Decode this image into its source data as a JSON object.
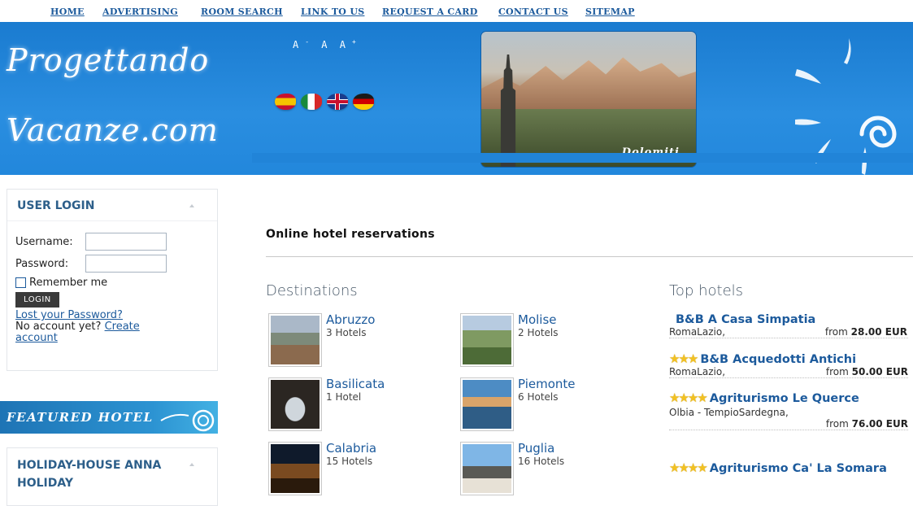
{
  "nav": {
    "items": [
      "HOME",
      "ADVERTISING",
      "ROOM SEARCH",
      "LINK TO US",
      "REQUEST A CARD",
      "CONTACT US",
      "SITEMAP"
    ]
  },
  "header": {
    "logo_line1": "Progettando",
    "logo_line2": "Vacanze.com",
    "font_small": "A",
    "font_normal": "A",
    "font_large": "A",
    "photo_label": "Dolomiti",
    "flags": [
      "Spanish",
      "Italian",
      "English",
      "German"
    ]
  },
  "login": {
    "title": "USER LOGIN",
    "username_label": "Username:",
    "password_label": "Password:",
    "remember_label": "Remember me",
    "login_button": "LOGIN",
    "lost_password": "Lost your Password?",
    "no_account": "No account yet?",
    "create_account": "Create account"
  },
  "featured_banner": "FEATURED HOTEL",
  "holiday_box": {
    "title_line1": "HOLIDAY-HOUSE ANNA",
    "title_line2": "HOLIDAY"
  },
  "main": {
    "page_title": "Online hotel reservations",
    "destinations_title": "Destinations",
    "top_hotels_title": "Top hotels"
  },
  "destinations": [
    {
      "name": "Abruzzo",
      "count": "3 Hotels"
    },
    {
      "name": "Molise",
      "count": "2 Hotels"
    },
    {
      "name": "Basilicata",
      "count": "1 Hotel"
    },
    {
      "name": "Piemonte",
      "count": "6 Hotels"
    },
    {
      "name": "Calabria",
      "count": "15 Hotels"
    },
    {
      "name": "Puglia",
      "count": "16 Hotels"
    }
  ],
  "hotels": [
    {
      "stars": 0,
      "name": "B&B A Casa Simpatia",
      "location": "RomaLazio,",
      "price_prefix": "from",
      "price": "28.00 EUR"
    },
    {
      "stars": 3,
      "name": "B&B Acquedotti Antichi",
      "location": "RomaLazio,",
      "price_prefix": "from",
      "price": "50.00 EUR"
    },
    {
      "stars": 4,
      "name": "Agriturismo Le Querce",
      "location": "Olbia - TempioSardegna,",
      "price_prefix": "from",
      "price": "76.00 EUR"
    },
    {
      "stars": 4,
      "name": "Agriturismo Ca' La Somara",
      "location": "",
      "price_prefix": "",
      "price": ""
    }
  ],
  "colors": {
    "header_blue": "#2287dc",
    "link_blue": "#1c5a9c",
    "star_gold": "#f2c122"
  }
}
